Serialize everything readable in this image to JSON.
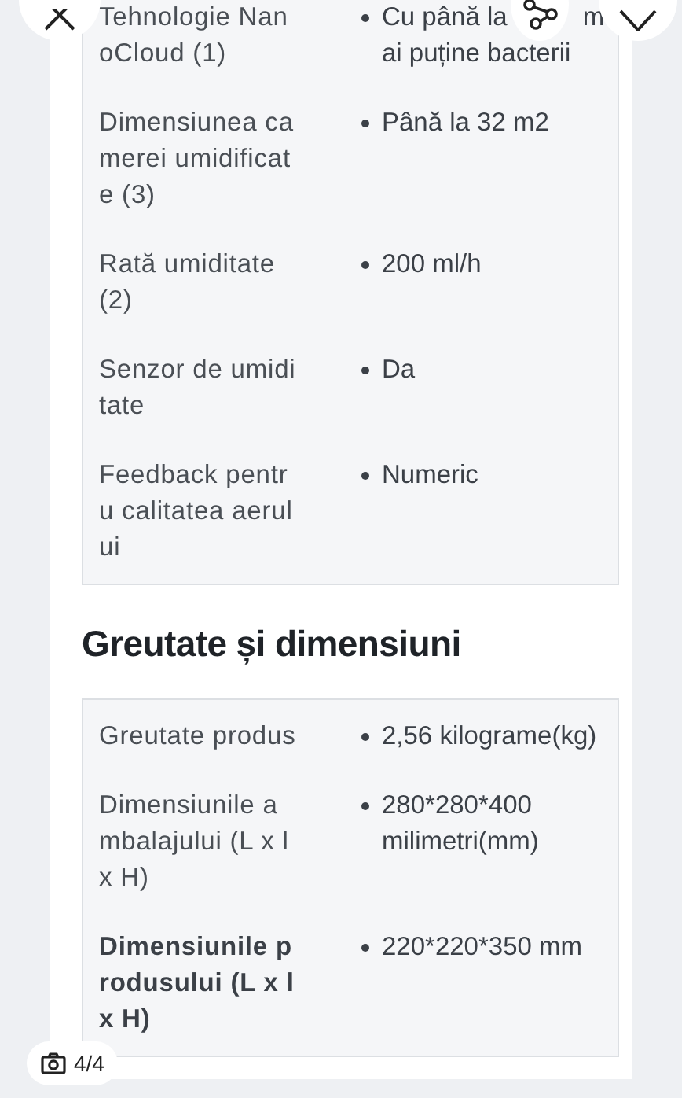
{
  "sections": [
    {
      "rows": [
        {
          "label": "Tehnologie NanoCloud (1)",
          "value": "Cu până la",
          "value_parts_after_cover": [
            "m",
            "ai puține bacterii"
          ],
          "emphasized": false
        },
        {
          "label": "Dimensiunea camerei umidificate (3)",
          "value": "Până la 32 m2",
          "emphasized": false
        },
        {
          "label": "Rată umiditate (2)",
          "value": "200 ml/h",
          "emphasized": false
        },
        {
          "label": "Senzor de umiditate",
          "value": "Da",
          "emphasized": false
        },
        {
          "label": "Feedback pentru calitatea aerului",
          "value": "Numeric",
          "emphasized": false
        }
      ]
    },
    {
      "heading": "Greutate și dimensiuni",
      "rows": [
        {
          "label": "Greutate produs",
          "value": "2,56 kilograme(kg)",
          "emphasized": false
        },
        {
          "label": "Dimensiunile ambalajului (L x l x H)",
          "value": "280*280*400 milimetri(mm)",
          "emphasized": false
        },
        {
          "label": "Dimensiunile produsului (L x l x H)",
          "value": "220*220*350 mm",
          "emphasized": true
        }
      ]
    }
  ],
  "photo_counter": "4/4"
}
